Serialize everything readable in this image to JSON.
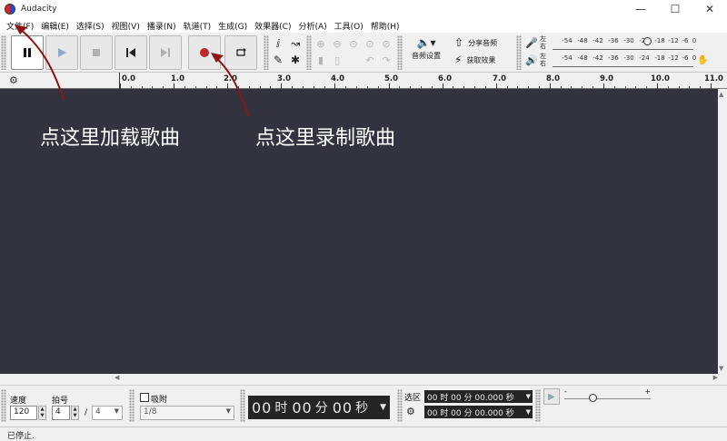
{
  "window": {
    "title": "Audacity"
  },
  "menu": [
    "文件(F)",
    "编辑(E)",
    "选择(S)",
    "视图(V)",
    "播录(N)",
    "轨道(T)",
    "生成(G)",
    "效果器(C)",
    "分析(A)",
    "工具(O)",
    "帮助(H)"
  ],
  "toolbar": {
    "audio_setup_label": "音频设置",
    "share_audio_label": "分享音频",
    "get_effects_label": "获取效果"
  },
  "meters": {
    "left_label": "左",
    "right_label": "右",
    "ticks": [
      "-54",
      "-48",
      "-42",
      "-36",
      "-30",
      "-24",
      "-18",
      "-12",
      "-6",
      "0"
    ]
  },
  "timeline": {
    "labels": [
      "0.0",
      "1.0",
      "2.0",
      "3.0",
      "4.0",
      "5.0",
      "6.0",
      "7.0",
      "8.0",
      "9.0",
      "10.0",
      "11.0"
    ]
  },
  "annotations": {
    "load": "点这里加载歌曲",
    "record": "点这里录制歌曲"
  },
  "selection_toolbar": {
    "tempo_label": "速度",
    "tempo_value": "120",
    "meter_label": "拍号",
    "meter_numerator": "4",
    "meter_separator": "/",
    "meter_denominator": "4",
    "snap_label": "吸附",
    "snap_value": "1/8",
    "time_display": {
      "hours": "00",
      "hours_unit": "时",
      "minutes": "00",
      "minutes_unit": "分",
      "seconds": "00",
      "seconds_unit": "秒"
    },
    "selection_label": "选区",
    "selection_start": "00 时 00 分 00.000 秒",
    "selection_end": "00 时 00 分 00.000 秒"
  },
  "status": {
    "text": "已停止."
  },
  "colors": {
    "track_background": "#32333f",
    "annotation_arrow": "#8b1414",
    "record_red": "#c0262a"
  }
}
